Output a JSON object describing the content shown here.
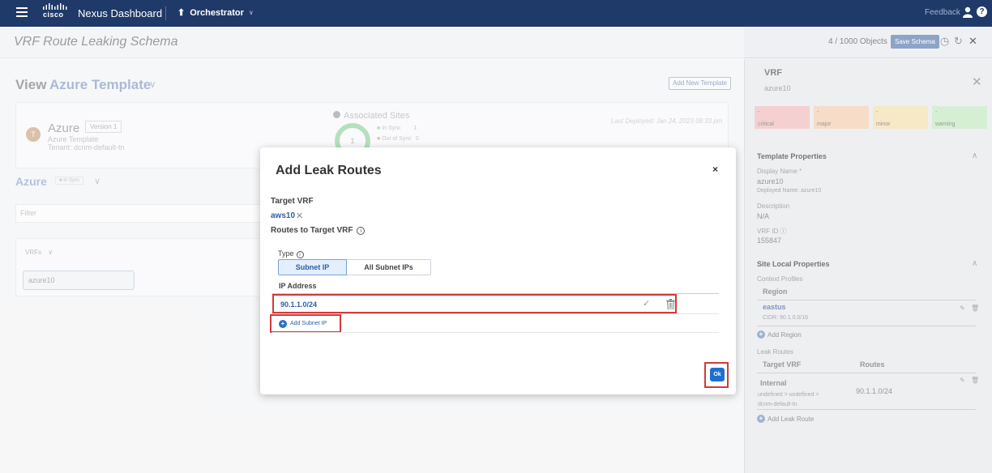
{
  "topbar": {
    "brand": "cisco",
    "app_title": "Nexus Dashboard",
    "app_selector": "Orchestrator",
    "feedback": "Feedback",
    "help": "?"
  },
  "header": {
    "title": "VRF Route Leaking Schema",
    "object_count": "4 / 1000 Objects",
    "save_label": "Save Schema"
  },
  "main": {
    "view_label": "View",
    "view_name": "Azure Template",
    "add_template": "Add New Template",
    "template": {
      "avatar": "T",
      "name": "Azure",
      "version": "Version 1",
      "type": "Azure Template",
      "tenant": "Tenant: dcnm-default-tn",
      "associated_sites": "Associated Sites",
      "sites_count": "1",
      "in_sync_label": "In Sync",
      "in_sync_count": "1",
      "out_of_sync_label": "Out of Sync",
      "out_of_sync_count": "0",
      "last_deployed": "Last Deployed: Jan 24, 2023 08:33 pm"
    },
    "site_name": "Azure",
    "site_sync": "In Sync",
    "filter_placeholder": "Filter",
    "vrfs_label": "VRFs",
    "vrf_item": "azure10"
  },
  "right_panel": {
    "title": "VRF",
    "subtitle": "azure10",
    "faults": [
      {
        "count": "-",
        "label": "critical",
        "color": "#f5d0d0"
      },
      {
        "count": "-",
        "label": "major",
        "color": "#f7dcc8"
      },
      {
        "count": "-",
        "label": "minor",
        "color": "#f7e8c6"
      },
      {
        "count": "-",
        "label": "warning",
        "color": "#d5efd3"
      }
    ],
    "template_properties": "Template Properties",
    "display_name_label": "Display Name *",
    "display_name": "azure10",
    "deployed_name": "Deployed Name: azure10",
    "description_label": "Description",
    "description": "N/A",
    "vrf_id_label": "VRF ID",
    "vrf_id": "155847",
    "site_local": "Site Local Properties",
    "context_profiles": "Context Profiles",
    "region_header": "Region",
    "region": "eastus",
    "region_cidr": "CIDR: 90.1.0.0/16",
    "add_region": "Add Region",
    "leak_routes": "Leak Routes",
    "target_vrf_header": "Target VRF",
    "routes_header": "Routes",
    "leak_target": "Internal",
    "leak_target_sub": "undefined > undefined > dcnm-default-tn",
    "leak_route": "90.1.1.0/24",
    "add_leak_route": "Add Leak Route"
  },
  "modal": {
    "title": "Add Leak Routes",
    "close": "×",
    "target_vrf_label": "Target VRF",
    "target_vrf": "aws10",
    "routes_label": "Routes to Target VRF",
    "type_label": "Type",
    "type_options": [
      "Subnet IP",
      "All Subnet IPs"
    ],
    "ip_header": "IP Address",
    "ip_value": "90.1.1.0/24",
    "add_subnet": "Add Subnet IP",
    "ok": "Ok"
  }
}
